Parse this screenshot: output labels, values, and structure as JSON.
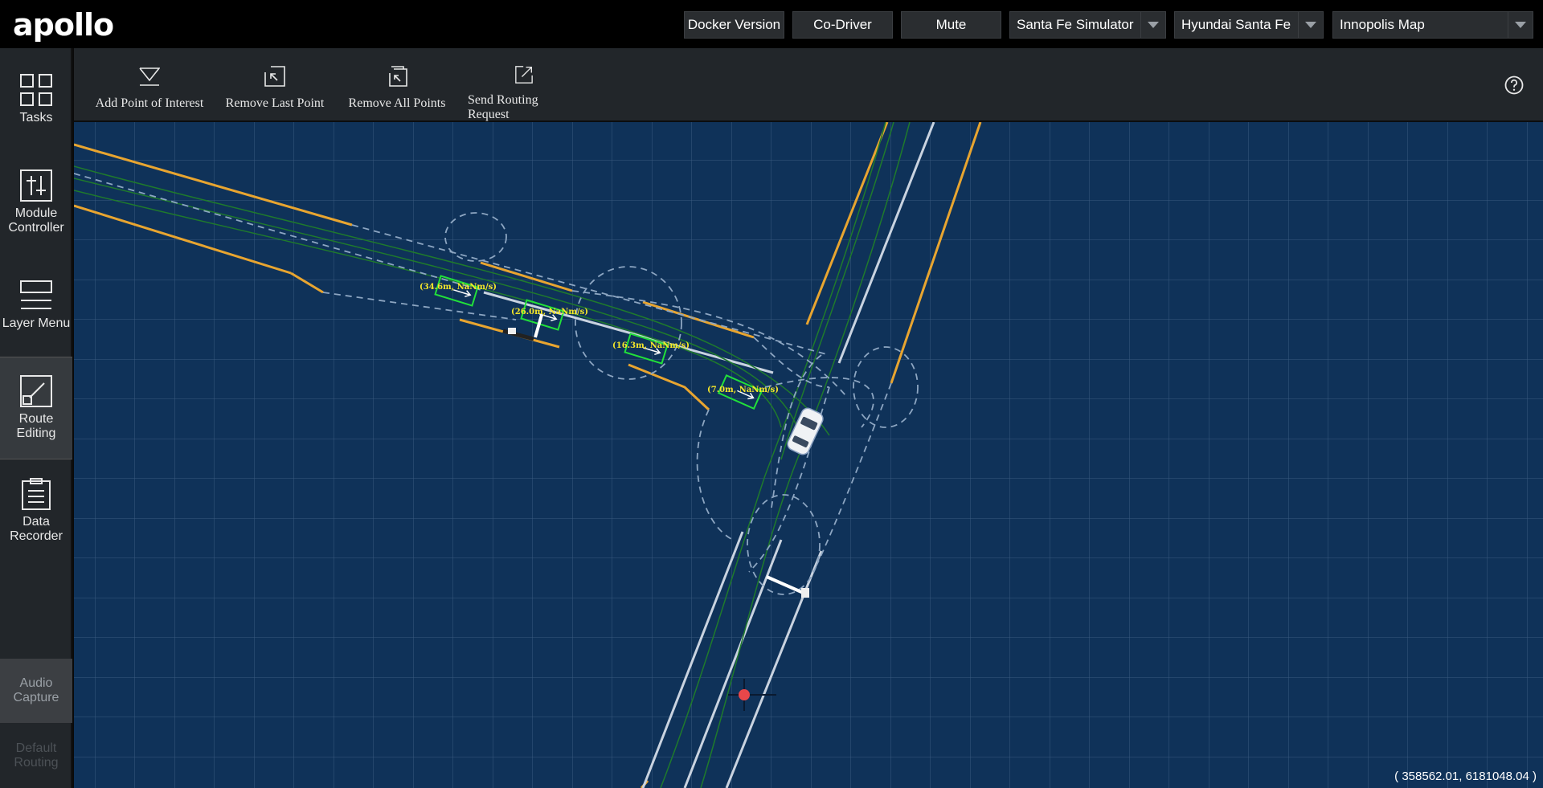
{
  "app": {
    "logo": "apollo"
  },
  "header": {
    "docker_label": "Docker Version",
    "codriver_label": "Co-Driver",
    "mute_label": "Mute",
    "mode_select": "Santa Fe Simulator",
    "vehicle_select": "Hyundai Santa Fe",
    "map_select": "Innopolis Map"
  },
  "sidebar": {
    "items": [
      {
        "label": "Tasks",
        "icon": "grid-icon"
      },
      {
        "label": "Module Controller",
        "icon": "sliders-icon"
      },
      {
        "label": "Layer Menu",
        "icon": "layers-icon"
      },
      {
        "label": "Route Editing",
        "icon": "route-edit-icon"
      },
      {
        "label": "Data Recorder",
        "icon": "clipboard-icon"
      }
    ],
    "audio_capture": "Audio Capture",
    "default_routing": "Default Routing"
  },
  "toolbar": {
    "add_poi": "Add Point of Interest",
    "remove_last": "Remove Last Point",
    "remove_all": "Remove All Points",
    "send_routing": "Send Routing Request"
  },
  "map": {
    "obstacle_labels": [
      "(34.6m, NaNm/s)",
      "(26.0m, NaNm/s)",
      "(16.3m, NaNm/s)",
      "(7.0m, NaNm/s)"
    ],
    "coordinates": "( 358562.01, 6181048.04 )",
    "colors": {
      "background": "#0f3259",
      "lane_yellow": "#e8a530",
      "obstacle_green": "#22e03a",
      "label_yellow": "#f5e62a"
    }
  }
}
